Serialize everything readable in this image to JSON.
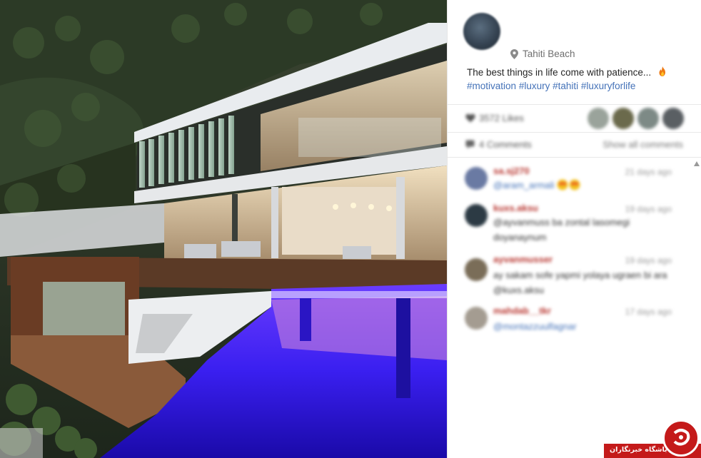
{
  "post": {
    "location": "Tahiti Beach",
    "caption": "The best things in life come with patience...",
    "hashtags": [
      "#motivation",
      "#luxury",
      "#tahiti",
      "#luxuryforlife"
    ]
  },
  "likes": {
    "text": "3572 Likes"
  },
  "comments": {
    "count_text": "4 Comments",
    "show_all": "Show all comments"
  },
  "comment_items": [
    {
      "user": "sa.sj270",
      "time": "21 days ago",
      "text": "@aram_armali",
      "emoji": true
    },
    {
      "user": "kuxs.aksu",
      "time": "19 days ago",
      "text": "@ayvanmuss ba zontal lasomegi doyanaynum"
    },
    {
      "user": "ayvanmusser",
      "time": "19 days ago",
      "text": "ay sakam sofe yapmi yolaya ugraen bi ara @kuxs.aksu"
    },
    {
      "user": "mahdab__tkr",
      "time": "17 days ago",
      "text": "@montazzuulfagnar"
    }
  ],
  "watermark": {
    "text": "باشگاه خبرنگاران"
  },
  "colors": {
    "hashtag": "#4472b8",
    "username": "#b8352f",
    "watermark": "#c41a1a"
  }
}
